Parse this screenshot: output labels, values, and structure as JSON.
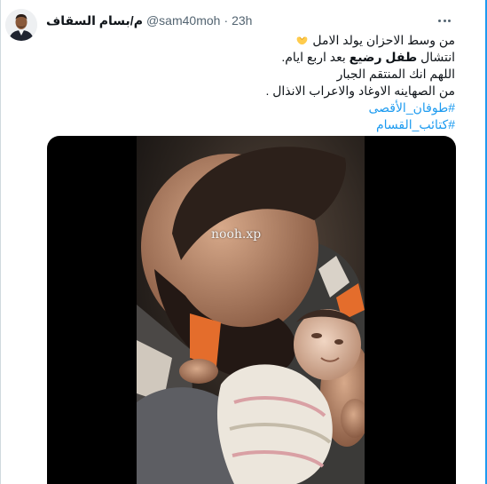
{
  "author": {
    "display_name": "م/بسام السقاف",
    "handle": "@sam40moh",
    "separator": "·",
    "time": "23h",
    "avatar_icon": "user-avatar"
  },
  "more_icon": "ellipsis-icon",
  "tweet": {
    "line1_text": "من وسط الاحزان يولد الامل",
    "line1_emoji": "heart-hands-emoji",
    "line2_before": "انتشال",
    "line2_bold": "طفل رضيع",
    "line2_after": "بعد اربع  ايام.",
    "line3": "اللهم انك المنتقم الجبار",
    "line4": "من الصهاينه الاوغاد والاعراب الانذال .",
    "hashtag1": "#طوفان_الأقصى",
    "hashtag2": "#كتائب_القسام"
  },
  "media": {
    "watermark": "nooh.xp"
  },
  "colors": {
    "link": "#1d9bf0",
    "text": "#0f1419",
    "secondary": "#536471",
    "scrollbar_accent": "#1d9bf0"
  }
}
